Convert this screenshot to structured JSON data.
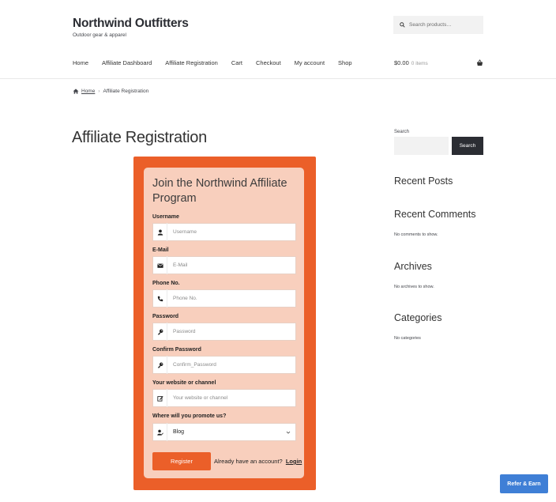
{
  "site": {
    "title": "Northwind Outfitters",
    "tagline": "Outdoor gear & apparel",
    "search_placeholder": "Search products…"
  },
  "nav": {
    "items": [
      "Home",
      "Affiliate Dashboard",
      "Affiliate Registration",
      "Cart",
      "Checkout",
      "My account",
      "Shop"
    ],
    "cart_amount": "$0.00",
    "cart_items": "0 items"
  },
  "breadcrumb": {
    "home": "Home",
    "separator": "›",
    "current": "Affiliate Registration"
  },
  "page": {
    "title": "Affiliate Registration"
  },
  "form": {
    "heading": "Join the Northwind Affiliate Program",
    "fields": [
      {
        "label": "Username",
        "placeholder": "Username",
        "icon": "user-icon"
      },
      {
        "label": "E-Mail",
        "placeholder": "E-Mail",
        "icon": "envelope-icon"
      },
      {
        "label": "Phone No.",
        "placeholder": "Phone No.",
        "icon": "phone-icon"
      },
      {
        "label": "Password",
        "placeholder": "Password",
        "icon": "key-icon"
      },
      {
        "label": "Confirm Password",
        "placeholder": "Confirm_Password",
        "icon": "key-icon"
      },
      {
        "label": "Your website or channel",
        "placeholder": "Your website or channel",
        "icon": "edit-icon"
      }
    ],
    "promote": {
      "label": "Where will you promote us?",
      "selected": "Blog",
      "icon": "user-edit-icon"
    },
    "register_label": "Register",
    "login_prompt": "Already have an account?",
    "login_label": "Login",
    "accent_color": "#eb5f29",
    "panel_color": "#f8cfbd"
  },
  "sidebar": {
    "search_label": "Search",
    "search_button": "Search",
    "recent_posts": "Recent Posts",
    "recent_comments": "Recent Comments",
    "no_comments": "No comments to show.",
    "archives": "Archives",
    "no_archives": "No archives to show.",
    "categories": "Categories",
    "no_categories": "No categories"
  },
  "floating": {
    "refer_label": "Refer & Earn",
    "color": "#3f7fd6"
  }
}
